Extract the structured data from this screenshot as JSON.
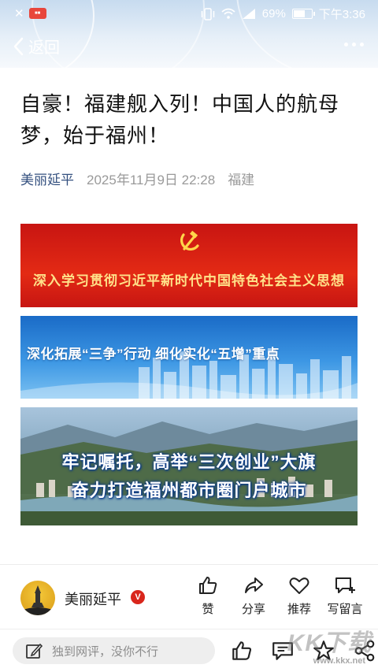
{
  "status_bar": {
    "battery_text": "69%",
    "battery_level": 0.69,
    "time": "下午3:36"
  },
  "nav": {
    "back_label": "返回"
  },
  "article": {
    "title": "自豪！福建舰入列！中国人的航母梦，始于福州！",
    "author": "美丽延平",
    "datetime": "2025年11月9日 22:28",
    "location": "福建"
  },
  "banners": {
    "red_text": "深入学习贯彻习近平新时代中国特色社会主义思想",
    "blue_text": "深化拓展“三争”行动  细化实化“五增”重点",
    "photo_line1": "牢记嘱托，高举“三次创业”大旗",
    "photo_line2": "奋力打造福州都市圈门户城市"
  },
  "cut_text": "",
  "author_bar": {
    "name": "美丽延平",
    "verified_mark": "V",
    "actions": [
      {
        "label": "赞",
        "icon": "thumbs-up-icon"
      },
      {
        "label": "分享",
        "icon": "share-arrow-icon"
      },
      {
        "label": "推荐",
        "icon": "heart-icon"
      },
      {
        "label": "写留言",
        "icon": "comment-plus-icon"
      }
    ]
  },
  "comment_bar": {
    "placeholder": "独到网评，没你不行",
    "icons": [
      "thumbs-up-icon",
      "comment-icon",
      "star-icon",
      "share-icon"
    ]
  },
  "watermark": {
    "logo": "KK下载",
    "url": "www.kkx.net"
  },
  "colors": {
    "author_blue": "#34507f",
    "banner_red": "#d41d12",
    "banner_blue": "#2f86d9",
    "verified_red": "#d9261c"
  }
}
